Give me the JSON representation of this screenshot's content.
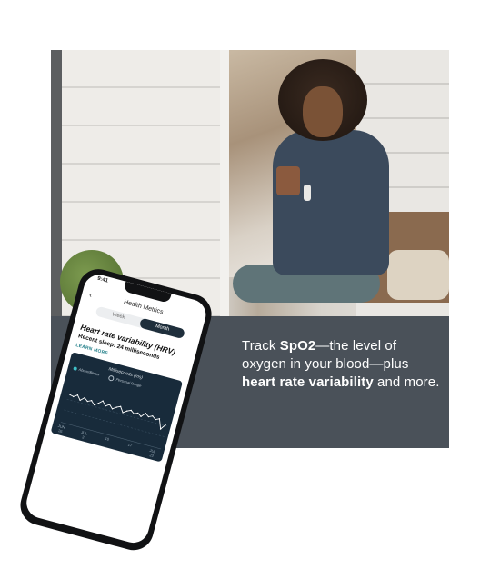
{
  "caption": {
    "part1": "Track ",
    "spo2": "SpO2",
    "part2": "—the level of oxygen in your blood—plus ",
    "hrv": "heart rate variability",
    "part3": " and more."
  },
  "phone": {
    "status_time": "9:41",
    "back_icon": "chevron-left-icon",
    "screen_title": "Health Metrics",
    "tabs": [
      {
        "label": "Week",
        "selected": false
      },
      {
        "label": "Month",
        "selected": true
      }
    ],
    "metric_title": "Heart rate variability (HRV)",
    "recent": "Recent sleep: 24 milliseconds",
    "learn_more": "LEARN MORE",
    "chart_title": "Milliseconds (ms)",
    "legend": {
      "series": "Above/Below",
      "range": "Personal Range"
    },
    "colors": {
      "chart_bg": "#182b3b",
      "accent": "#1e7d87",
      "line": "#ffffff"
    }
  },
  "chart_data": {
    "type": "line",
    "title": "Milliseconds (ms)",
    "x_ticks": [
      {
        "m": "JUN",
        "d": "26"
      },
      {
        "m": "JUL",
        "d": "3"
      },
      {
        "m": "",
        "d": "10"
      },
      {
        "m": "",
        "d": "17"
      },
      {
        "m": "JUL",
        "d": "22"
      }
    ],
    "series": [
      {
        "name": "Above/Below",
        "values": [
          33,
          32,
          35,
          30,
          34,
          31,
          33,
          29,
          32,
          36,
          31,
          34,
          30,
          33,
          35,
          29,
          32,
          34,
          31,
          33,
          30,
          35,
          32,
          34,
          31,
          33,
          22,
          28
        ]
      }
    ],
    "ylim": [
      0,
      50
    ]
  }
}
